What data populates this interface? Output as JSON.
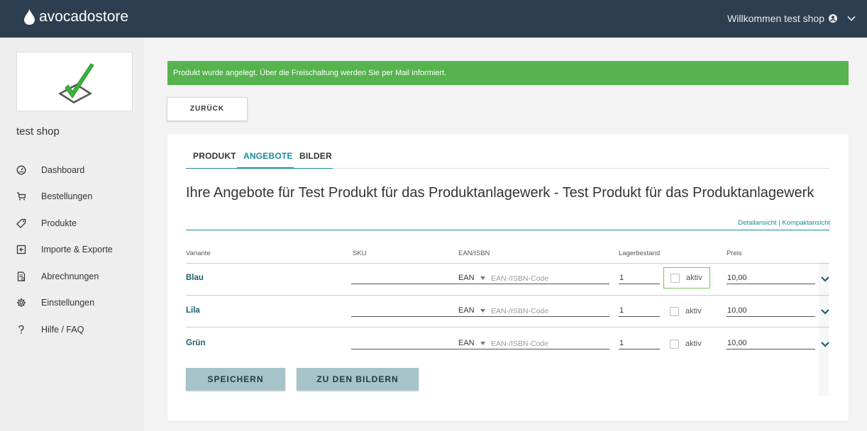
{
  "header": {
    "brand": "avocadostore",
    "welcome": "Willkommen test shop"
  },
  "sidebar": {
    "shop_name": "test shop",
    "items": [
      {
        "label": "Dashboard",
        "icon": "dashboard-gauge-icon"
      },
      {
        "label": "Bestellungen",
        "icon": "cart-icon"
      },
      {
        "label": "Produkte",
        "icon": "tag-icon"
      },
      {
        "label": "Importe & Exporte",
        "icon": "import-export-icon"
      },
      {
        "label": "Abrechnungen",
        "icon": "invoice-icon"
      },
      {
        "label": "Einstellungen",
        "icon": "gear-icon"
      },
      {
        "label": "Hilfe / FAQ",
        "icon": "question-icon"
      }
    ]
  },
  "alert": {
    "text": "Produkt wurde angelegt. Über die Freischaltung werden Sie per Mail informiert.",
    "color": "#56b34e"
  },
  "back_button": "ZURÜCK",
  "tabs": [
    {
      "label": "PRODUKT",
      "active": false
    },
    {
      "label": "ANGEBOTE",
      "active": true
    },
    {
      "label": "BILDER",
      "active": false
    }
  ],
  "offers": {
    "heading": "Ihre Angebote für Test Produkt für das Produktanlagewerk - Test Produkt für das Produktanlagewerk",
    "view_links": {
      "detail": "Detailansicht",
      "separator": " | ",
      "compact": "Kompaktansicht"
    },
    "columns": {
      "variant": "Variante",
      "sku": "SKU",
      "ean": "EAN/ISBN",
      "stock": "Lagerbestand",
      "price": "Preis"
    },
    "rows": [
      {
        "variant": "Blau",
        "sku": "",
        "ean_type": "EAN",
        "ean_placeholder": "EAN-/ISBN-Code",
        "stock": "1",
        "active_label": "aktiv",
        "active": false,
        "price": "10,00"
      },
      {
        "variant": "Lila",
        "sku": "",
        "ean_type": "EAN",
        "ean_placeholder": "EAN-/ISBN-Code",
        "stock": "1",
        "active_label": "aktiv",
        "active": false,
        "price": "10,00"
      },
      {
        "variant": "Grün",
        "sku": "",
        "ean_type": "EAN",
        "ean_placeholder": "EAN-/ISBN-Code",
        "stock": "1",
        "active_label": "aktiv",
        "active": false,
        "price": "10,00"
      }
    ],
    "save_button": "SPEICHERN",
    "images_button": "ZU DEN BILDERN"
  },
  "colors": {
    "topbar": "#2d3e50",
    "accent": "#1a8b9a",
    "button": "#a6c3c9"
  }
}
